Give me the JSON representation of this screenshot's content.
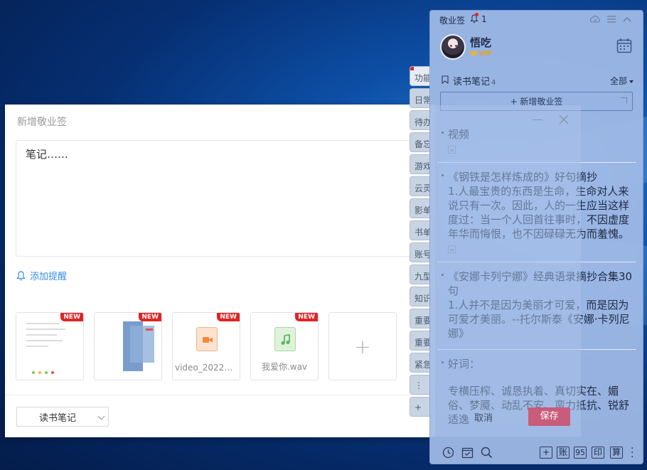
{
  "new_note": {
    "title": "新增敬业签",
    "editor_text": "笔记……",
    "reminder_label": "添加提醒",
    "attachments": [
      {
        "badge": "NEW",
        "name": ""
      },
      {
        "badge": "NEW",
        "name": ""
      },
      {
        "badge": "NEW",
        "name": "video_202207..."
      },
      {
        "badge": "NEW",
        "name": "我爱你.wav"
      }
    ],
    "add_attachment": "+",
    "category": "读书笔记"
  },
  "tabs": [
    "功能",
    "日常",
    "待办",
    "备忘",
    "游戏",
    "云灵",
    "影单",
    "书单",
    "账号",
    "九型",
    "知识",
    "重要",
    "重要",
    "紧急",
    "⋮",
    "+"
  ],
  "sticky": {
    "app_name": "敬业签",
    "notification_count": "1",
    "user": {
      "name": "悟吃",
      "badge": "VIP"
    },
    "section": {
      "title": "读书笔记",
      "count": "4",
      "filter": "全部"
    },
    "new_button": "+ 新增敬业签",
    "notes": [
      {
        "title": "视频",
        "body": "",
        "has_image": true
      },
      {
        "title": "《钢铁是怎样炼成的》好句摘抄",
        "body": "1.人最宝贵的东西是生命，生命对人来说只有一次。因此，人的一生应当这样度过：当一个人回首往事时，不因虚度年华而悔恨，也不因碌碌无为而羞愧。",
        "has_image": true
      },
      {
        "title": "《安娜卡列宁娜》经典语录摘抄合集30句",
        "body": "1.人并不是因为美丽才可爱，而是因为可爱才美丽。--托尔斯泰《安娜·卡列尼娜》",
        "has_image": false
      },
      {
        "title": "好词：",
        "body": "专横压榨、诚恳执着、真切实在、媚俗、梦魇、动乱不安、蛮力抵抗、锐舒适逸",
        "has_image": false
      }
    ],
    "footer_buttons": [
      "+",
      "账",
      "95",
      "印",
      "算"
    ]
  },
  "overlay": {
    "secondary_button": "取消",
    "primary_button": "保存"
  },
  "colors": {
    "accent_blue": "#3a8ee6",
    "badge_red": "#e02424",
    "sticky_bg": "#a0bae6",
    "save_button": "#c95c7a"
  }
}
